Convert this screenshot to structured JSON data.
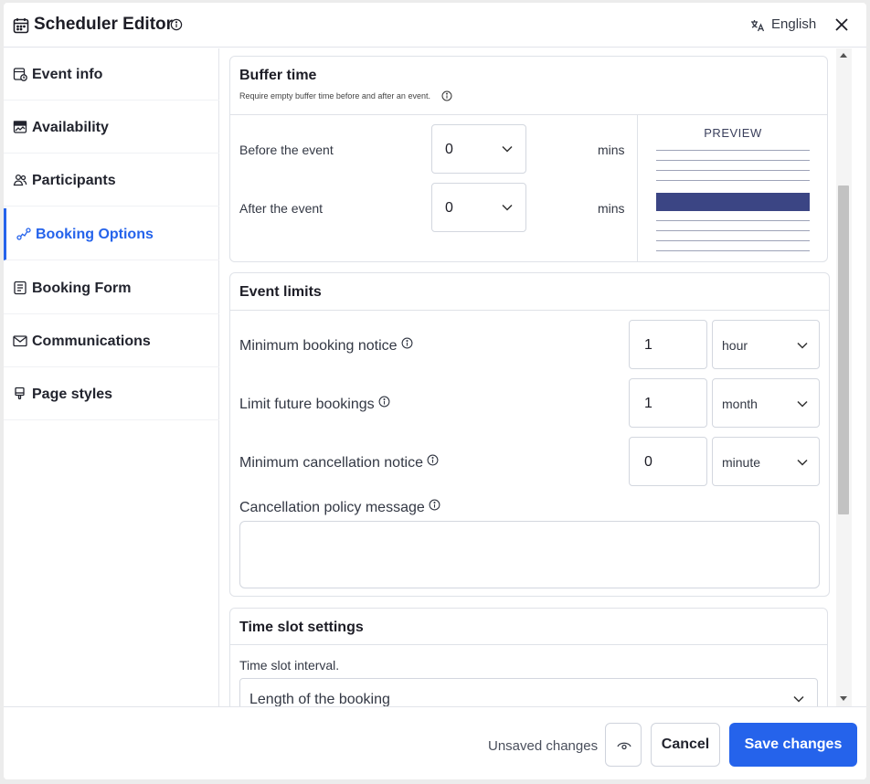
{
  "header": {
    "title": "Scheduler Editor",
    "language": "English"
  },
  "sidebar": {
    "items": [
      {
        "label": "Event info",
        "icon": "calendar-clock-icon"
      },
      {
        "label": "Availability",
        "icon": "availability-icon"
      },
      {
        "label": "Participants",
        "icon": "people-icon"
      },
      {
        "label": "Booking Options",
        "icon": "route-icon",
        "active": true
      },
      {
        "label": "Booking Form",
        "icon": "form-icon"
      },
      {
        "label": "Communications",
        "icon": "mail-icon"
      },
      {
        "label": "Page styles",
        "icon": "brush-icon"
      }
    ]
  },
  "buffer_time": {
    "title": "Buffer time",
    "subtitle": "Require empty buffer time before and after an event.",
    "before_label": "Before the event",
    "before_value": "0",
    "after_label": "After the event",
    "after_value": "0",
    "unit": "mins",
    "preview_label": "PREVIEW"
  },
  "event_limits": {
    "title": "Event limits",
    "min_booking_label": "Minimum booking notice",
    "min_booking_value": "1",
    "min_booking_unit": "hour",
    "future_label": "Limit future bookings",
    "future_value": "1",
    "future_unit": "month",
    "cancel_label": "Minimum cancellation notice",
    "cancel_value": "0",
    "cancel_unit": "minute",
    "policy_label": "Cancellation policy message",
    "policy_value": ""
  },
  "time_slot": {
    "title": "Time slot settings",
    "interval_label": "Time slot interval.",
    "interval_value": "Length of the booking"
  },
  "footer": {
    "status": "Unsaved changes",
    "cancel": "Cancel",
    "save": "Save changes"
  },
  "colors": {
    "accent": "#2563eb",
    "preview_block": "#3b4584"
  }
}
